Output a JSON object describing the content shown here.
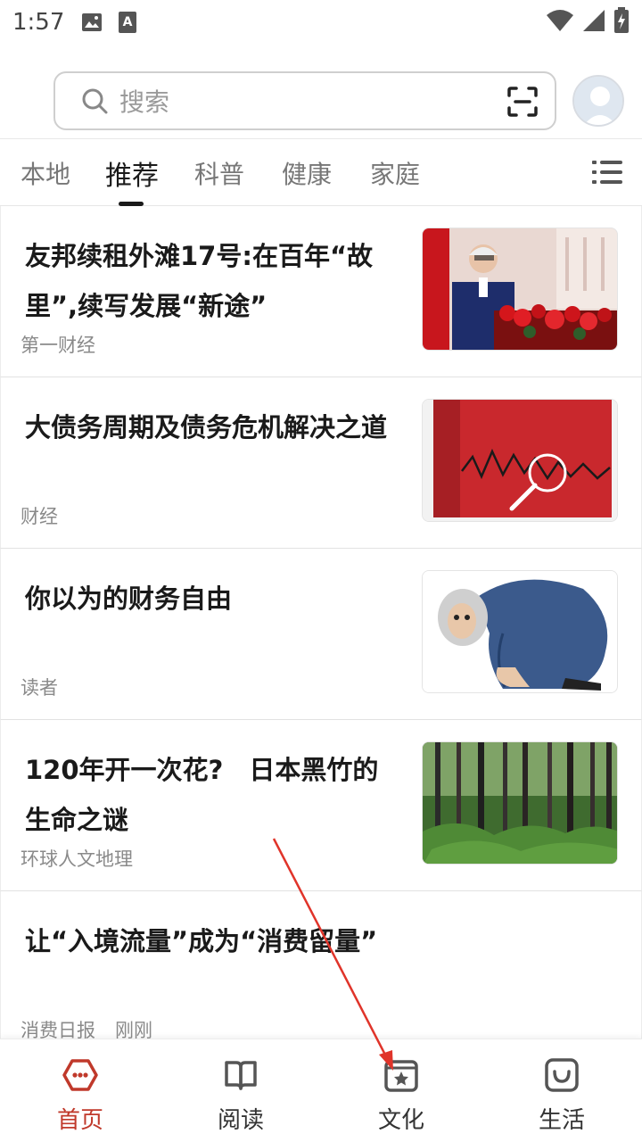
{
  "status_bar": {
    "time": "1:57",
    "icons": [
      "image-icon",
      "text-a-icon",
      "wifi-icon",
      "signal-icon",
      "battery-icon"
    ]
  },
  "search": {
    "placeholder": "搜索",
    "scan_icon": "scan-icon",
    "avatar_icon": "avatar-icon"
  },
  "tabs": [
    {
      "label": "本地",
      "active": false
    },
    {
      "label": "推荐",
      "active": true
    },
    {
      "label": "科普",
      "active": false
    },
    {
      "label": "健康",
      "active": false
    },
    {
      "label": "家庭",
      "active": false
    }
  ],
  "tab_menu_icon": "list-menu-icon",
  "feed": [
    {
      "title": "友邦续租外滩17号:在百年“故里”,续写发展“新途”",
      "source": "第一财经",
      "thumb": "speaker-podium-photo"
    },
    {
      "title": "大债务周期及债务危机解决之道",
      "source": "财经",
      "thumb": "book-cover-photo"
    },
    {
      "title": "你以为的财务自由",
      "source": "读者",
      "thumb": "cartoon-illustration"
    },
    {
      "title": "120年开一次花?　日本黑竹的生命之谜",
      "source": "环球人文地理",
      "thumb": "bamboo-forest-photo"
    },
    {
      "title": "让“入境流量”成为“消费留量”",
      "source": "消费日报",
      "time": "刚刚"
    }
  ],
  "bottom_nav": [
    {
      "label": "首页",
      "icon": "home-hexagon-icon",
      "active": true
    },
    {
      "label": "阅读",
      "icon": "book-icon",
      "active": false
    },
    {
      "label": "文化",
      "icon": "star-box-icon",
      "active": false
    },
    {
      "label": "生活",
      "icon": "smile-bag-icon",
      "active": false
    }
  ],
  "colors": {
    "accent": "#c0392b",
    "annotation_arrow": "#e0342a"
  }
}
